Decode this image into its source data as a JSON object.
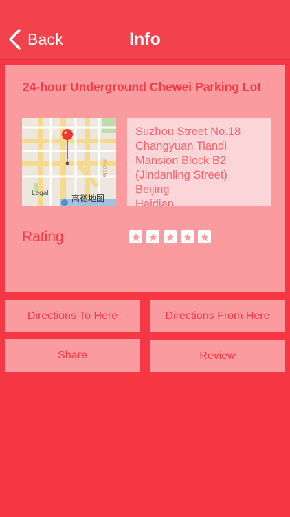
{
  "nav": {
    "back_label": "Back",
    "title": "Info"
  },
  "place": {
    "name": "24-hour Underground Chewei Parking Lot",
    "address": "Suzhou Street No.18\nChangyuan Tiandi\nMansion Block B2\n(Jindanling Street)\nBeijing\nHaidian",
    "map": {
      "legal_label": "Legal",
      "provider_label": "高德地图"
    }
  },
  "rating": {
    "label": "Rating",
    "value": 0,
    "max": 5
  },
  "actions": {
    "directions_to": "Directions To Here",
    "directions_from": "Directions From Here",
    "share": "Share",
    "review": "Review"
  },
  "colors": {
    "background": "#f73844",
    "navbar": "#f2424b",
    "card": "#fa9ba0",
    "accent_text": "#f73844"
  }
}
